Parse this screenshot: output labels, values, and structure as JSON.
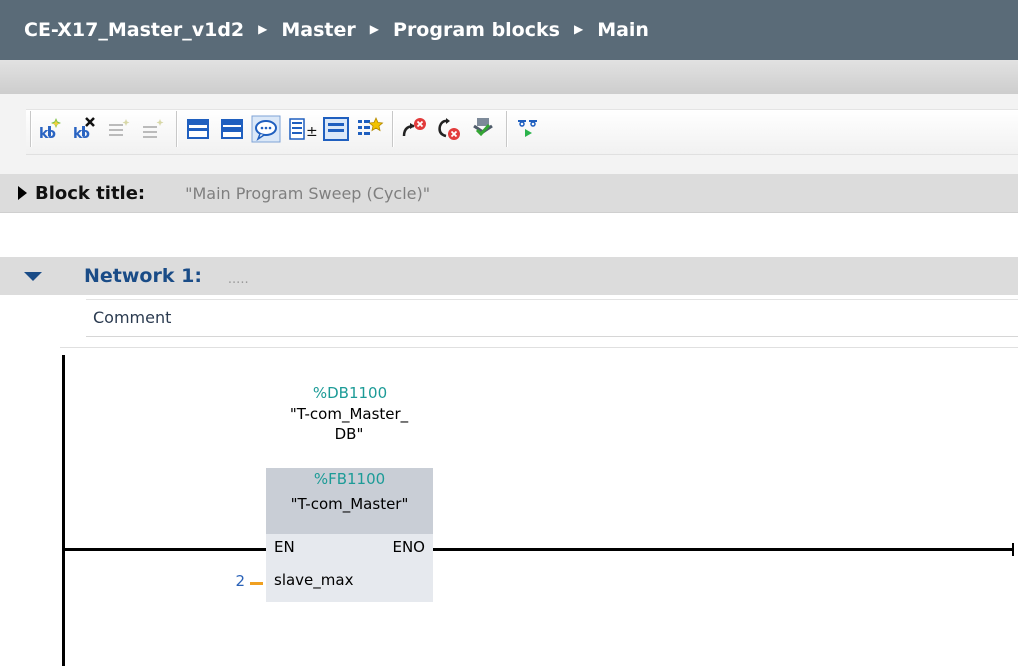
{
  "breadcrumb": {
    "items": [
      "CE-X17_Master_v1d2",
      "Master",
      "Program blocks",
      "Main"
    ],
    "separator": "▶"
  },
  "toolbar": {
    "icons": [
      "insert-network-icon",
      "delete-network-icon",
      "insert-row-icon",
      "add-row-icon",
      "open-all-networks-icon",
      "close-all-networks-icon",
      "show-comments-icon",
      "absolute-operands-icon",
      "favorites-icon",
      "navigation-icon",
      "go-to-error-icon",
      "previous-error-icon",
      "next-error-icon",
      "update-calls-icon",
      "monitoring-icon"
    ]
  },
  "block": {
    "title_label": "Block title:",
    "title_value": "\"Main Program Sweep (Cycle)\""
  },
  "network": {
    "title": "Network 1:",
    "dots": ".....",
    "comment": "Comment"
  },
  "ladder": {
    "instance_db_address": "%DB1100",
    "instance_db_name_line1": "\"T-com_Master_",
    "instance_db_name_line2": "DB\"",
    "fb_address": "%FB1100",
    "fb_name": "\"T-com_Master\"",
    "pin_en": "EN",
    "pin_eno": "ENO",
    "input_pin": "slave_max",
    "input_value": "2"
  },
  "colors": {
    "breadcrumb_bg": "#5a6b78",
    "network_title": "#1a4c87",
    "address_teal": "#1c9b97",
    "constant_blue": "#2a62b8",
    "wire_orange": "#f0a020"
  }
}
